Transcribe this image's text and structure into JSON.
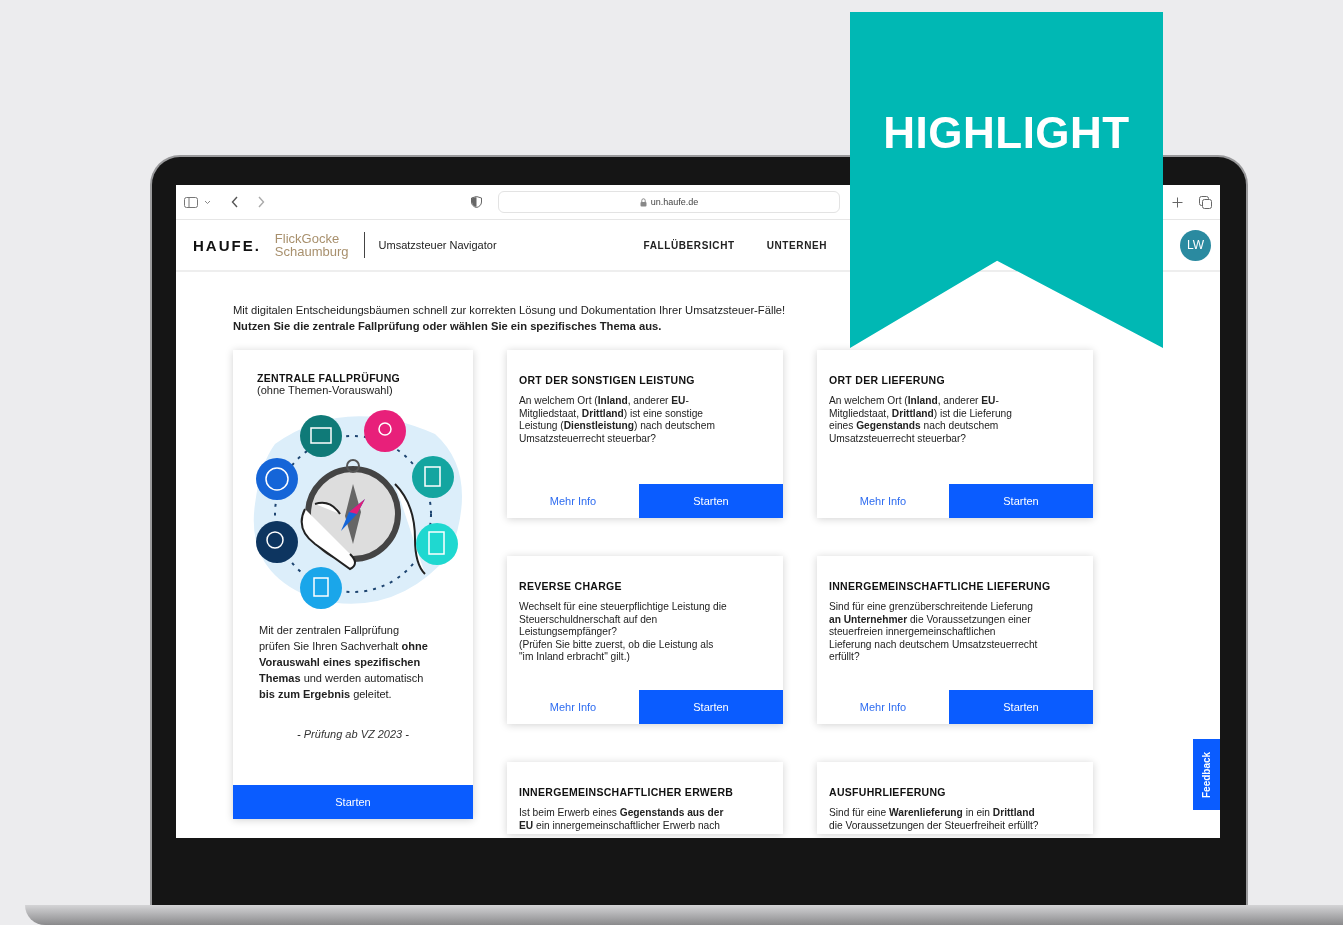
{
  "browser": {
    "url": "un.haufe.de"
  },
  "header": {
    "logo": "HAUFE.",
    "partner_logo": [
      "FlickGocke",
      "Schaumburg"
    ],
    "app_title": "Umsatzsteuer Navigator",
    "nav": [
      {
        "label": "FALLÜBERSICHT"
      },
      {
        "label": "UNTERNEH"
      }
    ],
    "avatar": "LW"
  },
  "intro": {
    "line1": "Mit digitalen Entscheidungsbäumen schnell zur korrekten Lösung und Dokumentation Ihrer Umsatzsteuer-Fälle!",
    "line2": "Nutzen Sie die zentrale Fallprüfung oder wählen Sie ein spezifisches Thema aus."
  },
  "featured_card": {
    "title": "ZENTRALE FALLPRÜFUNG",
    "subtitle": "(ohne Themen-Vorauswahl)",
    "description": "Mit der zentralen Fallprüfung\nprüfen Sie Ihren Sachverhalt **ohne\nVorauswahl eines spezifischen\nThemas** und werden automatisch\n**bis zum Ergebnis** geleitet.",
    "note": "- Prüfung ab VZ 2023 -",
    "button": "Starten"
  },
  "topic_cards": [
    {
      "title": "ORT DER SONSTIGEN LEISTUNG",
      "text": "An welchem Ort (**Inland**, anderer **EU**-\nMitgliedstaat, **Drittland**) ist eine sonstige\nLeistung (**Dienstleistung**) nach deutschem\nUmsatzsteuerrecht steuerbar?",
      "info_link": "Mehr Info",
      "button": "Starten"
    },
    {
      "title": "ORT DER LIEFERUNG",
      "text": "An welchem Ort (**Inland**, anderer **EU**-\nMitgliedstaat, **Drittland**) ist die Lieferung\neines **Gegenstands** nach deutschem\nUmsatzsteuerrecht steuerbar?",
      "info_link": "Mehr Info",
      "button": "Starten"
    },
    {
      "title": "REVERSE CHARGE",
      "text": "Wechselt für eine steuerpflichtige Leistung die\nSteuerschuldnerschaft auf den\nLeistungsempfänger?\n(Prüfen Sie bitte zuerst, ob die Leistung als\n\"im Inland erbracht\" gilt.)",
      "info_link": "Mehr Info",
      "button": "Starten"
    },
    {
      "title": "INNERGEMEINSCHAFTLICHE LIEFERUNG",
      "text": "Sind für eine grenzüberschreitende Lieferung\n**an Unternehmer** die Voraussetzungen einer\nsteuerfreien innergemeinschaftlichen\nLieferung nach deutschem Umsatzsteuerrecht\nerfüllt?",
      "info_link": "Mehr Info",
      "button": "Starten"
    },
    {
      "title": "INNERGEMEINSCHAFTLICHER ERWERB",
      "text": "Ist beim Erwerb eines **Gegenstands aus der\nEU** ein innergemeinschaftlicher Erwerb nach"
    },
    {
      "title": "AUSFUHRLIEFERUNG",
      "text": "Sind für eine **Warenlieferung** in ein **Drittland**\ndie Voraussetzungen der Steuerfreiheit erfüllt?"
    }
  ],
  "feedback": "Feedback",
  "banner": "HIGHLIGHT"
}
